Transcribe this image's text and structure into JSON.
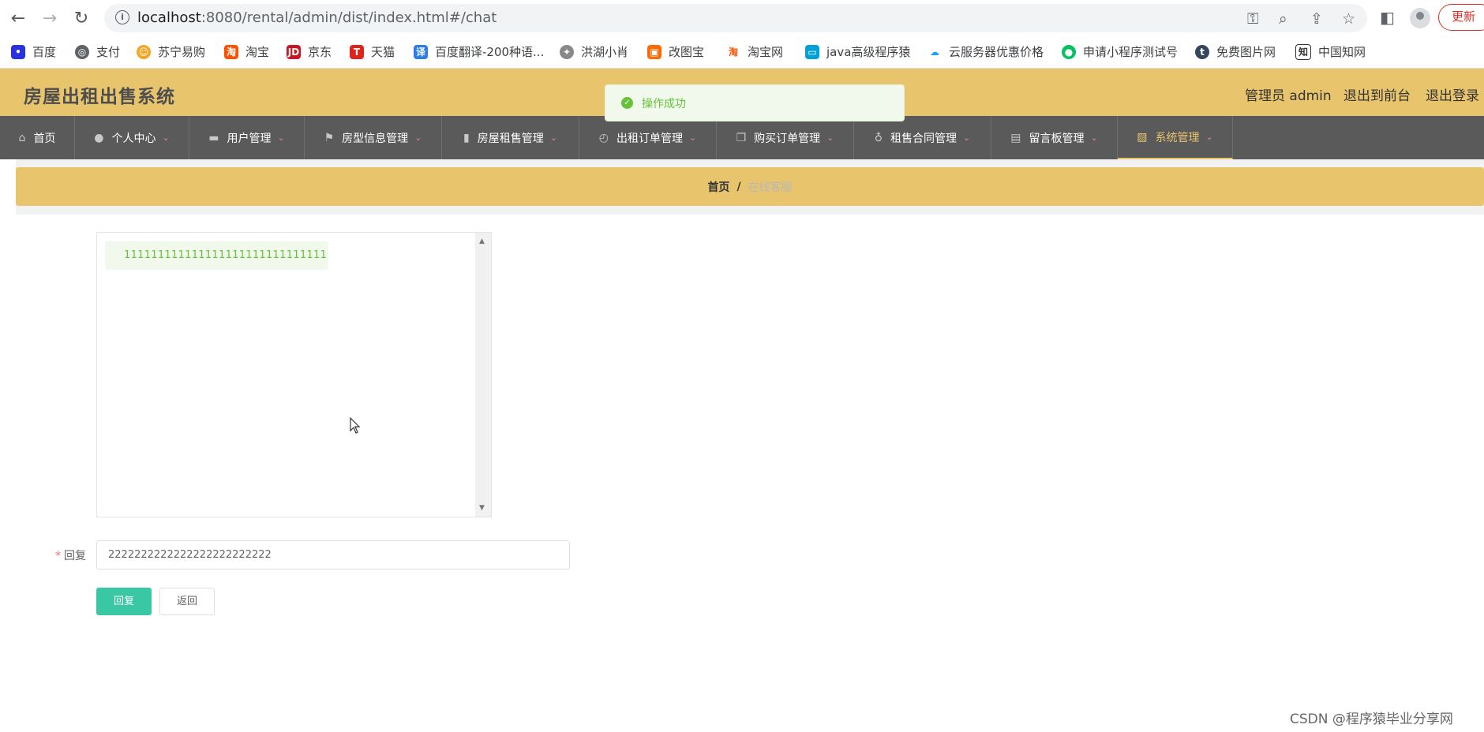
{
  "browser": {
    "url_host": "localhost",
    "url_path": ":8080/rental/admin/dist/index.html#/chat",
    "update_label": "更新",
    "bookmarks": [
      "百度",
      "支付",
      "苏宁易购",
      "淘宝",
      "京东",
      "天猫",
      "百度翻译-200种语...",
      "洪湖小肖",
      "改图宝",
      "淘宝网",
      "java高级程序猿",
      "云服务器优惠价格",
      "申请小程序测试号",
      "免费图片网",
      "中国知网"
    ]
  },
  "header": {
    "title": "房屋出租出售系统",
    "admin_label": "管理员 admin",
    "back_front_label": "退出到前台",
    "logout_label": "退出登录"
  },
  "toast": {
    "message": "操作成功"
  },
  "nav": {
    "items": [
      "首页",
      "个人中心",
      "用户管理",
      "房型信息管理",
      "房屋租售管理",
      "出租订单管理",
      "购买订单管理",
      "租售合同管理",
      "留言板管理",
      "系统管理"
    ],
    "active_index": 9
  },
  "breadcrumb": {
    "home": "首页",
    "separator": "/",
    "current": "在线客服"
  },
  "chat": {
    "messages": [
      "111111111111111111111111111111"
    ]
  },
  "form": {
    "reply_label": "回复",
    "reply_value": "2222222222222222222222222",
    "submit_label": "回复",
    "back_label": "返回"
  },
  "watermark": "CSDN @程序猿毕业分享网",
  "colors": {
    "header_bg": "#e8c56d",
    "nav_bg": "#5a5a5a",
    "primary": "#3ac7a4",
    "success": "#67c23a"
  }
}
